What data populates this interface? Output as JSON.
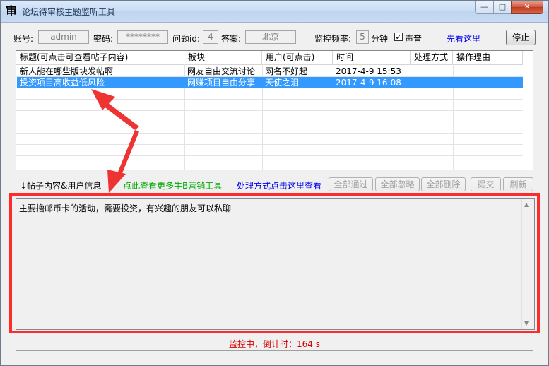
{
  "window": {
    "title": "论坛待审核主题监听工具",
    "icon_glyph": "审",
    "controls": {
      "minimize": "—",
      "maximize": "□",
      "close": "✕"
    }
  },
  "form": {
    "account_label": "账号:",
    "account_value": "admin",
    "password_label": "密码:",
    "password_value": "********",
    "question_id_label": "问题id:",
    "question_id_value": "4",
    "answer_label": "答案:",
    "answer_value": "北京",
    "frequency_label": "监控频率:",
    "frequency_value": "5",
    "frequency_unit": "分钟",
    "sound_label": "声音",
    "sound_checked": "✓",
    "see_here_link": "先看这里",
    "stop_button": "停止"
  },
  "table": {
    "columns": [
      "标题(可点击可查看帖子内容)",
      "板块",
      "用户(可点击)",
      "时间",
      "处理方式",
      "操作理由"
    ],
    "rows": [
      {
        "title": "新人能在哪些版块发帖啊",
        "board": "网友自由交流讨论",
        "user": "网名不好起",
        "time": "2017-4-9 15:53",
        "method": "",
        "reason": "",
        "selected": false
      },
      {
        "title": "投资项目高收益低风险",
        "board": "网赚项目自由分享",
        "user": "天使之泪",
        "time": "2017-4-9 16:08",
        "method": "",
        "reason": "",
        "selected": true
      }
    ]
  },
  "toolbar": {
    "post_info_label": "↓帖子内容&用户信息",
    "more_tools_link": "点此查看更多牛B营销工具",
    "process_link": "处理方式点击这里查看",
    "approve_all": "全部通过",
    "ignore_all": "全部忽略",
    "delete_all": "全部删除",
    "submit": "提交",
    "refresh": "刷新"
  },
  "post_content": "主要撸邮币卡的活动，需要投资，有兴趣的朋友可以私聊",
  "status": "监控中，倒计时：164 s",
  "colors": {
    "accent_red": "#ff2a2a",
    "selection": "#3399ff",
    "link_green": "#00aa00",
    "link_blue": "#0000ee",
    "status_red": "#d40000"
  }
}
